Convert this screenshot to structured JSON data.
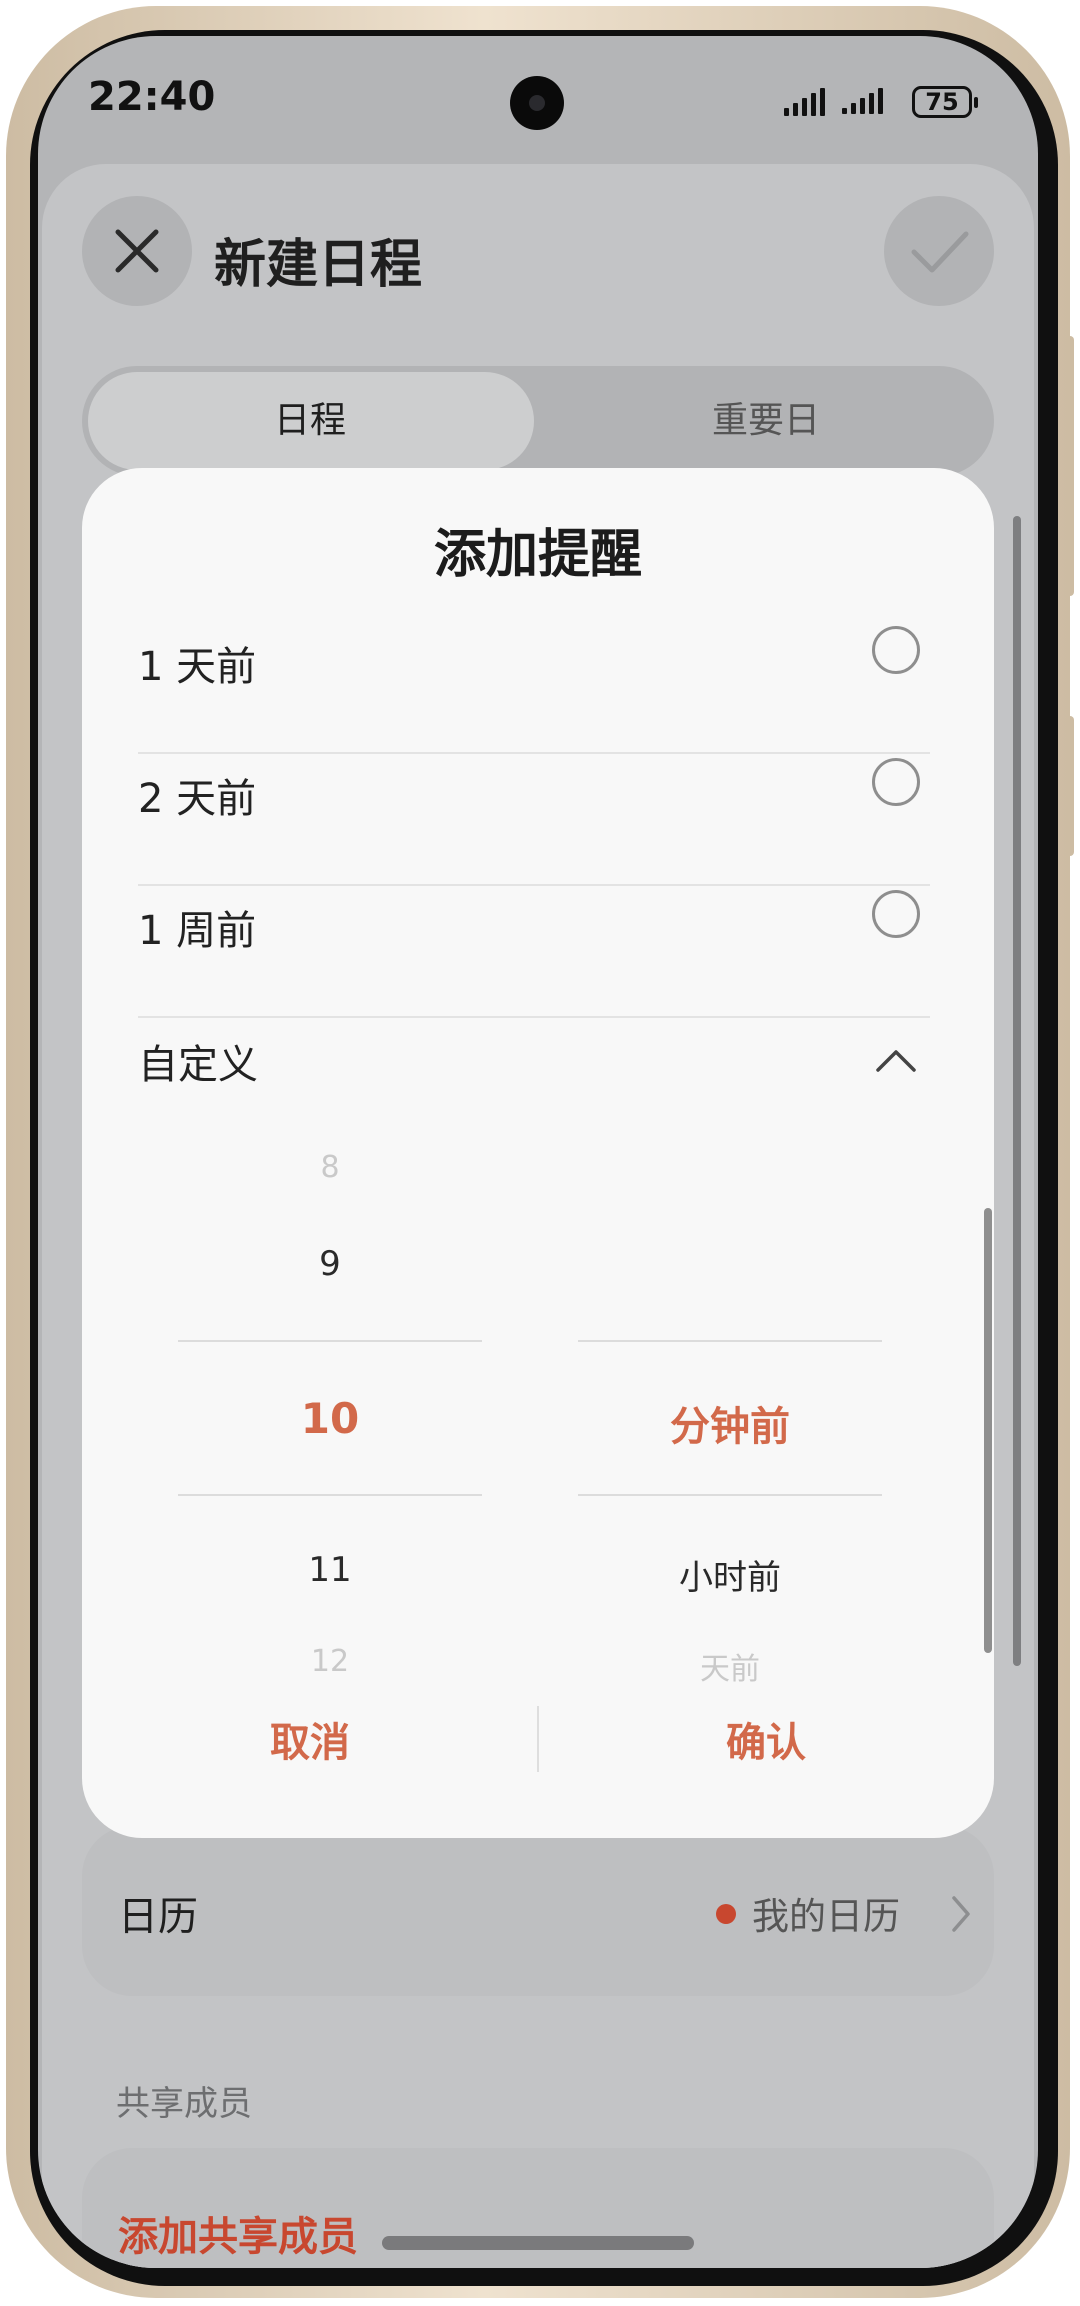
{
  "status_bar": {
    "time": "22:40",
    "battery": "75"
  },
  "header": {
    "title": "新建日程"
  },
  "tabs": {
    "active": "日程",
    "inactive": "重要日"
  },
  "dialog": {
    "title": "添加提醒",
    "options": [
      {
        "label": "1 天前"
      },
      {
        "label": "2 天前"
      },
      {
        "label": "1 周前"
      }
    ],
    "custom_label": "自定义",
    "picker": {
      "numbers": [
        "8",
        "9",
        "10",
        "11",
        "12"
      ],
      "selected_number": "10",
      "units": [
        "分钟前",
        "小时前",
        "天前"
      ],
      "selected_unit": "分钟前"
    },
    "cancel_label": "取消",
    "confirm_label": "确认"
  },
  "calendar_row": {
    "label": "日历",
    "value": "我的日历"
  },
  "shared": {
    "section_label": "共享成员",
    "add_label": "添加共享成员"
  },
  "colors": {
    "accent": "#d2694a",
    "calendar_dot": "#c8472f"
  }
}
